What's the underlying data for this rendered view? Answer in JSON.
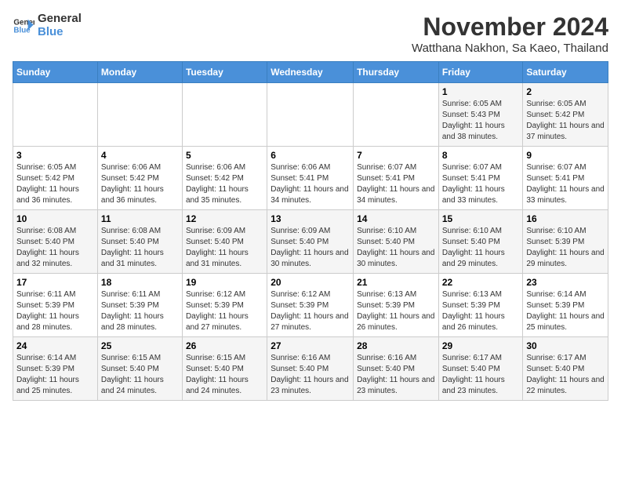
{
  "logo": {
    "line1": "General",
    "line2": "Blue"
  },
  "title": "November 2024",
  "subtitle": "Watthana Nakhon, Sa Kaeo, Thailand",
  "days_of_week": [
    "Sunday",
    "Monday",
    "Tuesday",
    "Wednesday",
    "Thursday",
    "Friday",
    "Saturday"
  ],
  "weeks": [
    [
      {
        "day": "",
        "info": ""
      },
      {
        "day": "",
        "info": ""
      },
      {
        "day": "",
        "info": ""
      },
      {
        "day": "",
        "info": ""
      },
      {
        "day": "",
        "info": ""
      },
      {
        "day": "1",
        "info": "Sunrise: 6:05 AM\nSunset: 5:43 PM\nDaylight: 11 hours and 38 minutes."
      },
      {
        "day": "2",
        "info": "Sunrise: 6:05 AM\nSunset: 5:42 PM\nDaylight: 11 hours and 37 minutes."
      }
    ],
    [
      {
        "day": "3",
        "info": "Sunrise: 6:05 AM\nSunset: 5:42 PM\nDaylight: 11 hours and 36 minutes."
      },
      {
        "day": "4",
        "info": "Sunrise: 6:06 AM\nSunset: 5:42 PM\nDaylight: 11 hours and 36 minutes."
      },
      {
        "day": "5",
        "info": "Sunrise: 6:06 AM\nSunset: 5:42 PM\nDaylight: 11 hours and 35 minutes."
      },
      {
        "day": "6",
        "info": "Sunrise: 6:06 AM\nSunset: 5:41 PM\nDaylight: 11 hours and 34 minutes."
      },
      {
        "day": "7",
        "info": "Sunrise: 6:07 AM\nSunset: 5:41 PM\nDaylight: 11 hours and 34 minutes."
      },
      {
        "day": "8",
        "info": "Sunrise: 6:07 AM\nSunset: 5:41 PM\nDaylight: 11 hours and 33 minutes."
      },
      {
        "day": "9",
        "info": "Sunrise: 6:07 AM\nSunset: 5:41 PM\nDaylight: 11 hours and 33 minutes."
      }
    ],
    [
      {
        "day": "10",
        "info": "Sunrise: 6:08 AM\nSunset: 5:40 PM\nDaylight: 11 hours and 32 minutes."
      },
      {
        "day": "11",
        "info": "Sunrise: 6:08 AM\nSunset: 5:40 PM\nDaylight: 11 hours and 31 minutes."
      },
      {
        "day": "12",
        "info": "Sunrise: 6:09 AM\nSunset: 5:40 PM\nDaylight: 11 hours and 31 minutes."
      },
      {
        "day": "13",
        "info": "Sunrise: 6:09 AM\nSunset: 5:40 PM\nDaylight: 11 hours and 30 minutes."
      },
      {
        "day": "14",
        "info": "Sunrise: 6:10 AM\nSunset: 5:40 PM\nDaylight: 11 hours and 30 minutes."
      },
      {
        "day": "15",
        "info": "Sunrise: 6:10 AM\nSunset: 5:40 PM\nDaylight: 11 hours and 29 minutes."
      },
      {
        "day": "16",
        "info": "Sunrise: 6:10 AM\nSunset: 5:39 PM\nDaylight: 11 hours and 29 minutes."
      }
    ],
    [
      {
        "day": "17",
        "info": "Sunrise: 6:11 AM\nSunset: 5:39 PM\nDaylight: 11 hours and 28 minutes."
      },
      {
        "day": "18",
        "info": "Sunrise: 6:11 AM\nSunset: 5:39 PM\nDaylight: 11 hours and 28 minutes."
      },
      {
        "day": "19",
        "info": "Sunrise: 6:12 AM\nSunset: 5:39 PM\nDaylight: 11 hours and 27 minutes."
      },
      {
        "day": "20",
        "info": "Sunrise: 6:12 AM\nSunset: 5:39 PM\nDaylight: 11 hours and 27 minutes."
      },
      {
        "day": "21",
        "info": "Sunrise: 6:13 AM\nSunset: 5:39 PM\nDaylight: 11 hours and 26 minutes."
      },
      {
        "day": "22",
        "info": "Sunrise: 6:13 AM\nSunset: 5:39 PM\nDaylight: 11 hours and 26 minutes."
      },
      {
        "day": "23",
        "info": "Sunrise: 6:14 AM\nSunset: 5:39 PM\nDaylight: 11 hours and 25 minutes."
      }
    ],
    [
      {
        "day": "24",
        "info": "Sunrise: 6:14 AM\nSunset: 5:39 PM\nDaylight: 11 hours and 25 minutes."
      },
      {
        "day": "25",
        "info": "Sunrise: 6:15 AM\nSunset: 5:40 PM\nDaylight: 11 hours and 24 minutes."
      },
      {
        "day": "26",
        "info": "Sunrise: 6:15 AM\nSunset: 5:40 PM\nDaylight: 11 hours and 24 minutes."
      },
      {
        "day": "27",
        "info": "Sunrise: 6:16 AM\nSunset: 5:40 PM\nDaylight: 11 hours and 23 minutes."
      },
      {
        "day": "28",
        "info": "Sunrise: 6:16 AM\nSunset: 5:40 PM\nDaylight: 11 hours and 23 minutes."
      },
      {
        "day": "29",
        "info": "Sunrise: 6:17 AM\nSunset: 5:40 PM\nDaylight: 11 hours and 23 minutes."
      },
      {
        "day": "30",
        "info": "Sunrise: 6:17 AM\nSunset: 5:40 PM\nDaylight: 11 hours and 22 minutes."
      }
    ]
  ]
}
